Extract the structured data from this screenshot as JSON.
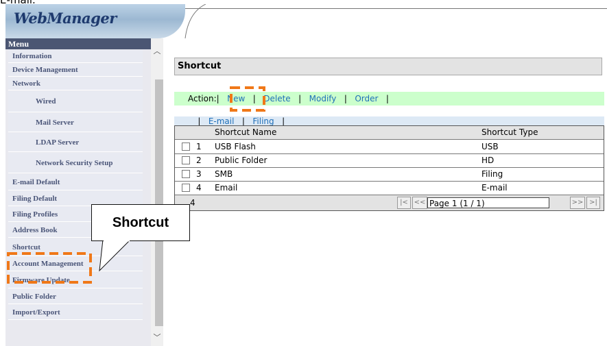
{
  "caption": "E-mail.",
  "header": {
    "logo": "WebManager"
  },
  "sidebar": {
    "title": "Menu",
    "items": [
      {
        "label": "Information",
        "sub": false
      },
      {
        "label": "Device Management",
        "sub": false
      },
      {
        "label": "Network",
        "sub": false
      },
      {
        "label": "Wired",
        "sub": true
      },
      {
        "label": "Mail Server",
        "sub": true
      },
      {
        "label": "LDAP Server",
        "sub": true
      },
      {
        "label": "Network Security Setup",
        "sub": true
      },
      {
        "label": "E-mail Default",
        "sub": false
      },
      {
        "label": "Filing Default",
        "sub": false
      },
      {
        "label": "Filing Profiles",
        "sub": false
      },
      {
        "label": "Address Book",
        "sub": false
      },
      {
        "label": "Shortcut",
        "sub": false
      },
      {
        "label": "Account Management",
        "sub": false
      },
      {
        "label": "Firmware Update",
        "sub": false
      },
      {
        "label": "Public Folder",
        "sub": false
      },
      {
        "label": "Import/Export",
        "sub": false
      }
    ]
  },
  "main": {
    "title": "Shortcut",
    "action": {
      "label": "Action:",
      "links": [
        "New",
        "Delete",
        "Modify",
        "Order"
      ]
    },
    "filters": [
      "E-mail",
      "Filing"
    ],
    "table": {
      "columns": [
        "Shortcut Name",
        "Shortcut Type"
      ],
      "rows": [
        {
          "num": "1",
          "name": "USB Flash",
          "type": "USB"
        },
        {
          "num": "2",
          "name": "Public Folder",
          "type": "HD"
        },
        {
          "num": "3",
          "name": "SMB",
          "type": "Filing"
        },
        {
          "num": "4",
          "name": "Email",
          "type": "E-mail"
        }
      ],
      "total": "4",
      "first_btn": "|<",
      "prev_btn": "<<",
      "page_value": "Page 1 (1 / 1)",
      "next_btn": ">>",
      "last_btn": ">|"
    }
  },
  "callout": {
    "text": "Shortcut"
  },
  "colors": {
    "highlight": "#f07818",
    "menu_head": "#4b5673",
    "action_bar": "#ccffcc",
    "link": "#1f6fb8"
  }
}
